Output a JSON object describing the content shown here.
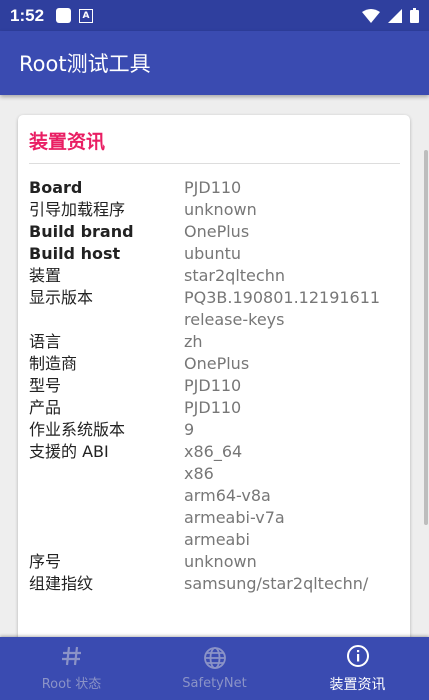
{
  "statusbar": {
    "time": "1:52"
  },
  "appbar": {
    "title": "Root测试工具"
  },
  "card": {
    "title": "装置资讯",
    "rows": [
      {
        "label": "Board",
        "bold": true,
        "values": [
          "PJD110"
        ]
      },
      {
        "label": "引导加载程序",
        "bold": false,
        "values": [
          "unknown"
        ]
      },
      {
        "label": "Build brand",
        "bold": true,
        "values": [
          "OnePlus"
        ]
      },
      {
        "label": "Build host",
        "bold": true,
        "values": [
          "ubuntu"
        ]
      },
      {
        "label": "装置",
        "bold": false,
        "values": [
          "star2qltechn"
        ]
      },
      {
        "label": "显示版本",
        "bold": false,
        "values": [
          "PQ3B.190801.12191611",
          "release-keys"
        ]
      },
      {
        "label": "语言",
        "bold": false,
        "values": [
          "zh"
        ]
      },
      {
        "label": "制造商",
        "bold": false,
        "values": [
          "OnePlus"
        ]
      },
      {
        "label": "型号",
        "bold": false,
        "values": [
          "PJD110"
        ]
      },
      {
        "label": "产品",
        "bold": false,
        "values": [
          "PJD110"
        ]
      },
      {
        "label": "作业系统版本",
        "bold": false,
        "values": [
          "9"
        ]
      },
      {
        "label": "支援的 ABI",
        "bold": false,
        "values": [
          "x86_64",
          "x86",
          "arm64-v8a",
          "armeabi-v7a",
          "armeabi"
        ]
      },
      {
        "label": "序号",
        "bold": false,
        "values": [
          "unknown"
        ]
      },
      {
        "label": "组建指纹",
        "bold": false,
        "values": [
          "samsung/star2qltechn/"
        ]
      }
    ]
  },
  "bottomnav": {
    "items": [
      {
        "id": "root-status",
        "label": "Root 状态",
        "icon": "hash-icon",
        "active": false
      },
      {
        "id": "safetynet",
        "label": "SafetyNet",
        "icon": "globe-icon",
        "active": false
      },
      {
        "id": "device-info",
        "label": "装置资讯",
        "icon": "info-icon",
        "active": true
      }
    ]
  },
  "colors": {
    "statusbar": "#2f3f9e",
    "appbar": "#3a4bb1",
    "title_accent": "#e91e63",
    "nav_inactive": "#8b93c7"
  }
}
